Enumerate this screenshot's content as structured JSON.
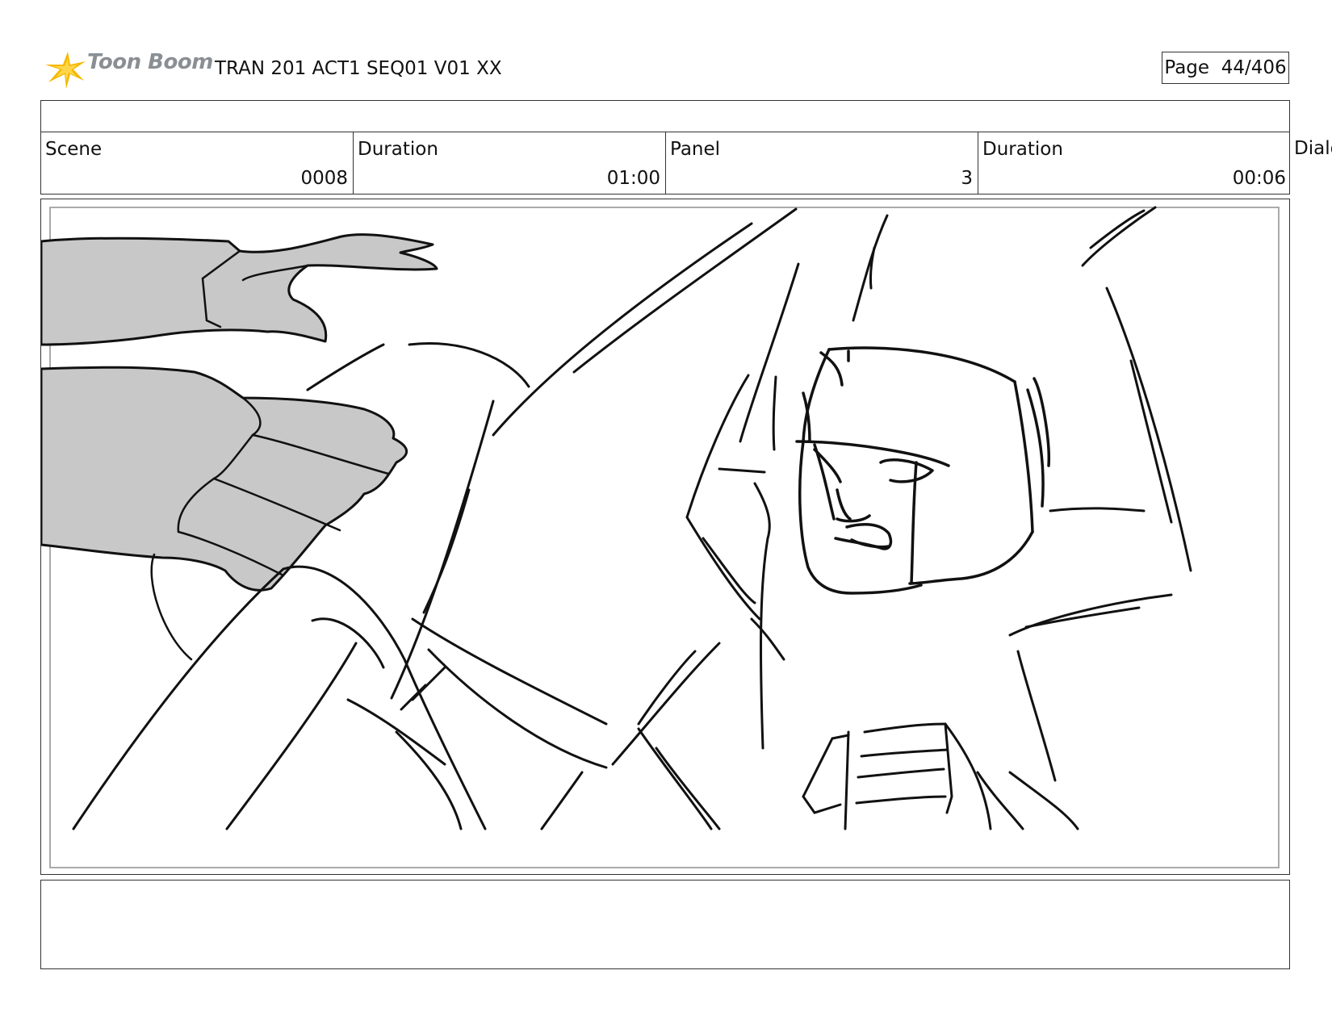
{
  "header": {
    "brand": "Toon Boom",
    "doc_title": "TRAN 201 ACT1 SEQ01 V01 XX",
    "page_label": "Page",
    "page_number": "44/406"
  },
  "info": {
    "scene_label": "Scene",
    "scene_value": "0008",
    "scene_duration_label": "Duration",
    "scene_duration_value": "01:00",
    "panel_label": "Panel",
    "panel_value": "3",
    "panel_duration_label": "Duration",
    "panel_duration_value": "00:06",
    "overflow_label": "Dialo"
  },
  "icons": {
    "brand_logo": "toon-boom-star-icon"
  },
  "colors": {
    "logo_yellow": "#f5b800",
    "logo_text": "#8a8f94",
    "hand_fill": "#c8c8c8",
    "sketch_ink": "#111111"
  }
}
